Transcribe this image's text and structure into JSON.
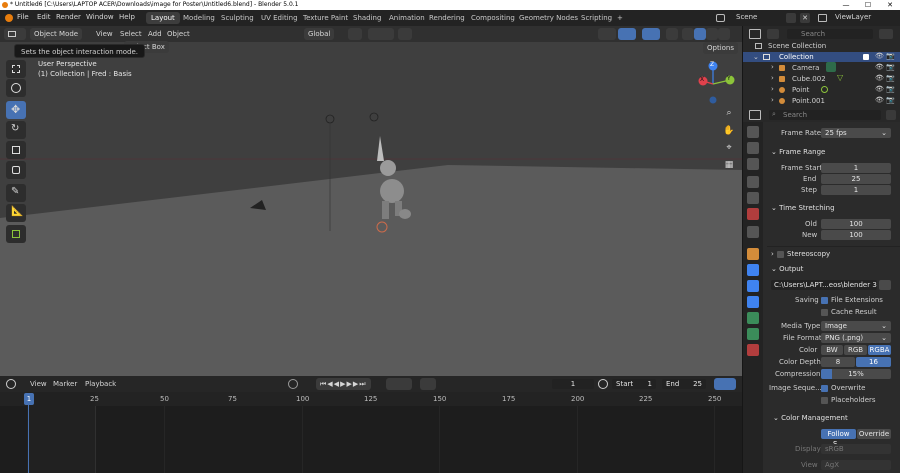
{
  "titlebar": {
    "title": "* Untitled6 [C:\\Users\\LAPTOP ACER\\Downloads\\image for Poster\\Untitled6.blend] - Blender 5.0.1",
    "minimize": "—",
    "maximize": "☐",
    "close": "✕"
  },
  "menu": {
    "items": [
      "File",
      "Edit",
      "Render",
      "Window",
      "Help"
    ]
  },
  "workspaces": {
    "tabs": [
      "Layout",
      "Modeling",
      "Sculpting",
      "UV Editing",
      "Texture Paint",
      "Shading",
      "Animation",
      "Rendering",
      "Compositing",
      "Geometry Nodes",
      "Scripting"
    ],
    "add": "+"
  },
  "scene": {
    "label": "Scene",
    "viewlayer": "ViewLayer"
  },
  "viewport": {
    "mode": "Object Mode",
    "menus": [
      "View",
      "Select",
      "Add",
      "Object"
    ],
    "select_box": "Select Box",
    "transform": "Global",
    "options": "Options",
    "tooltip": "Sets the object interaction mode.",
    "perspective": "User Perspective",
    "collection_info": "(1) Collection | Fred : Basis",
    "gizmo": {
      "z": "Z",
      "y": "Y",
      "x": "X"
    }
  },
  "timeline": {
    "menus": [
      "View",
      "Marker",
      "Playback"
    ],
    "current_frame": "1",
    "start_label": "Start",
    "start": "1",
    "end_label": "End",
    "end": "25",
    "ticks": [
      "1",
      "25",
      "50",
      "75",
      "100",
      "125",
      "150",
      "175",
      "200",
      "225",
      "250"
    ]
  },
  "outliner": {
    "search_placeholder": "Search",
    "root": "Scene Collection",
    "collection": "Collection",
    "items": [
      "Camera",
      "Cube.002",
      "Point",
      "Point.001"
    ]
  },
  "properties": {
    "search_placeholder": "Search",
    "frame_rate_label": "Frame Rate",
    "frame_rate": "25 fps",
    "frame_range": "Frame Range",
    "frame_start_label": "Frame Start",
    "frame_start": "1",
    "end_label": "End",
    "end": "25",
    "step_label": "Step",
    "step": "1",
    "time_stretching": "Time Stretching",
    "old_label": "Old",
    "old": "100",
    "new_label": "New",
    "new": "100",
    "stereoscopy": "Stereoscopy",
    "output": "Output",
    "output_path": "C:\\Users\\LAPT...eos\\blender 3d\\",
    "saving_label": "Saving",
    "file_extensions": "File Extensions",
    "cache_result": "Cache Result",
    "media_type_label": "Media Type",
    "media_type": "Image",
    "file_format_label": "File Format",
    "file_format": "PNG (.png)",
    "color_label": "Color",
    "color_opts": [
      "BW",
      "RGB",
      "RGBA"
    ],
    "color_depth_label": "Color Depth",
    "depth_opts": [
      "8",
      "16"
    ],
    "compression_label": "Compression",
    "compression": "15%",
    "compression_value": 0.15,
    "image_seq_label": "Image Seque...",
    "overwrite": "Overwrite",
    "placeholders": "Placeholders",
    "color_management": "Color Management",
    "follow_scene": "Follow S...",
    "override": "Override",
    "display_label": "Display",
    "display": "sRGB",
    "view_label": "View",
    "view": "AgX"
  },
  "colors": {
    "accent": "#4772b3",
    "viewport_bg": "#3f3f3f",
    "floor": "#5a5a5a",
    "x_axis": "#e0414c",
    "y_axis": "#8cc43a",
    "z_axis": "#3f83f0"
  }
}
